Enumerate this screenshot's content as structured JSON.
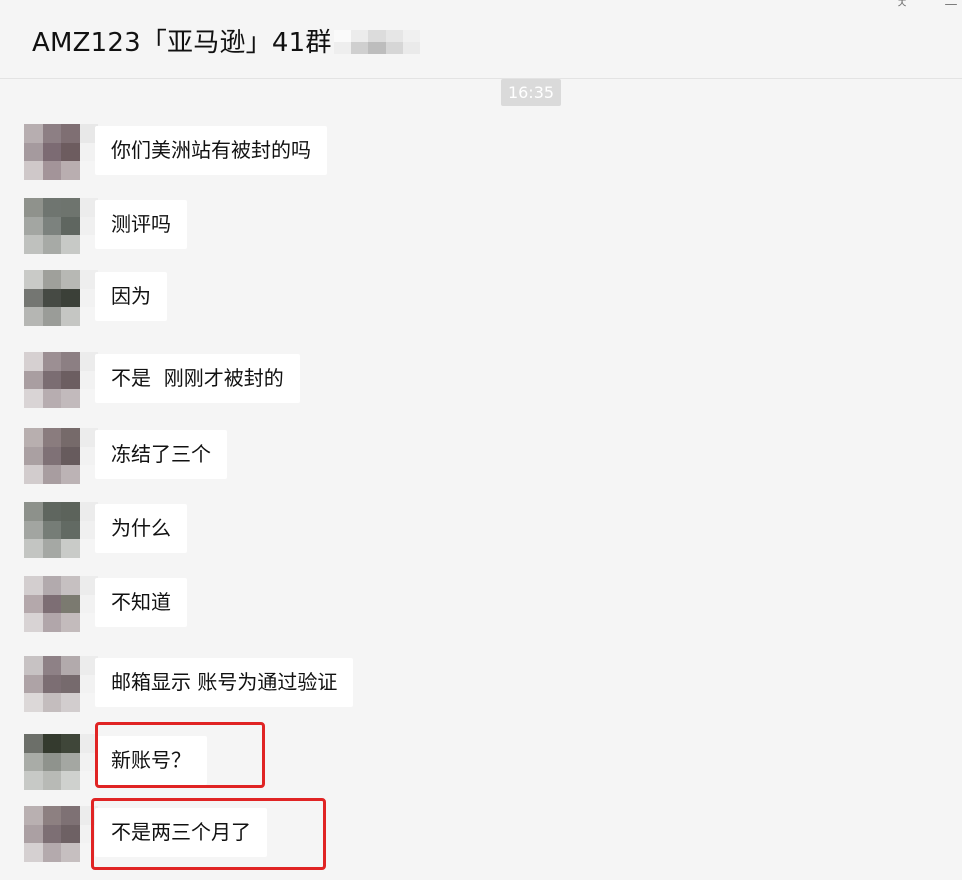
{
  "header": {
    "title": "AMZ123「亚马逊」41群",
    "pin_glyph": "ㅈ",
    "minimize_glyph": "—"
  },
  "timestamp": "16:35",
  "messages": [
    {
      "text": "你们美洲站有被封的吗",
      "highlighted": false
    },
    {
      "text": "测评吗",
      "highlighted": false
    },
    {
      "text": "因为",
      "highlighted": false
    },
    {
      "text": "不是  刚刚才被封的",
      "highlighted": false
    },
    {
      "text": "冻结了三个",
      "highlighted": false
    },
    {
      "text": "为什么",
      "highlighted": false
    },
    {
      "text": "不知道",
      "highlighted": false
    },
    {
      "text": "邮箱显示 账号为通过验证",
      "highlighted": false
    },
    {
      "text": "新账号？",
      "highlighted": true
    },
    {
      "text": "不是两三个月了",
      "highlighted": true
    }
  ],
  "colors": {
    "background": "#f5f5f5",
    "bubble": "#ffffff",
    "highlight": "#e02424",
    "timestamp_bg": "#dadada"
  }
}
